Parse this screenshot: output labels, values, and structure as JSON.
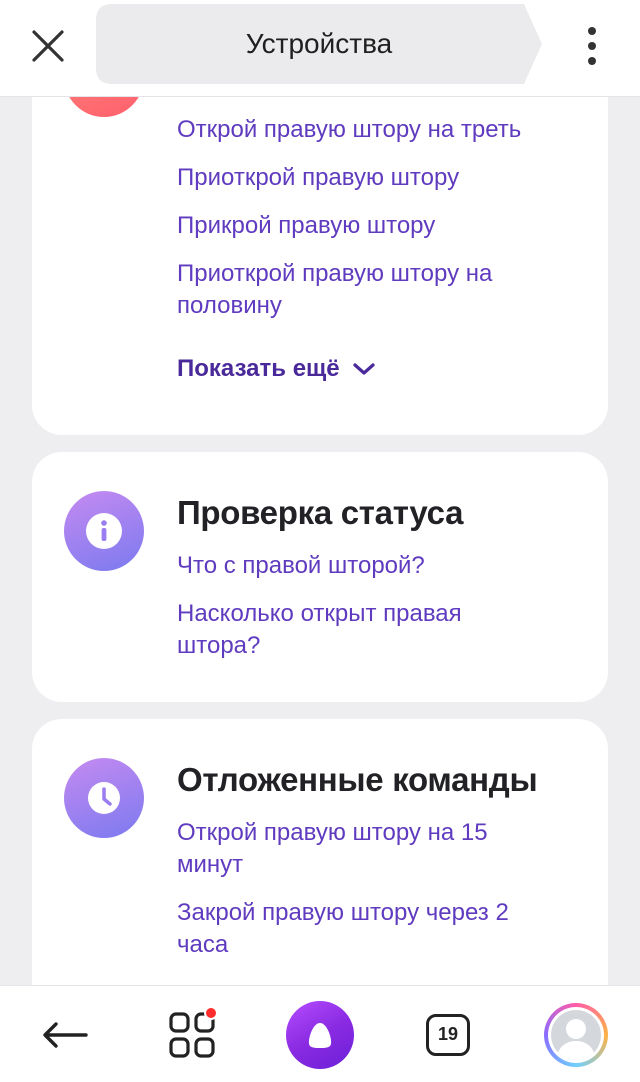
{
  "header": {
    "title": "Устройства",
    "close_icon": "close-icon",
    "more_icon": "more-vertical-icon"
  },
  "cards": [
    {
      "icon": "arrow-down-icon",
      "commands": [
        "Открой правую штору на треть",
        "Приоткрой правую штору",
        "Прикрой правую штору",
        "Приоткрой правую штору на половину"
      ],
      "show_more": "Показать ещё"
    },
    {
      "icon": "info-icon",
      "heading": "Проверка статуса",
      "commands": [
        "Что с правой шторой?",
        "Насколько открыт правая штора?"
      ]
    },
    {
      "icon": "clock-icon",
      "heading": "Отложенные команды",
      "commands": [
        "Открой правую штору на 15 минут",
        "Закрой правую штору через 2 часа"
      ]
    }
  ],
  "bottom_nav": {
    "back_icon": "back-arrow-icon",
    "services_icon": "grid-icon",
    "alice_icon": "alice-icon",
    "calendar_day": "19",
    "profile_icon": "avatar"
  },
  "colors": {
    "accent_text": "#5f3bbf",
    "alice_purple": "#8a2be2",
    "notification_red": "#ff2d2d"
  }
}
